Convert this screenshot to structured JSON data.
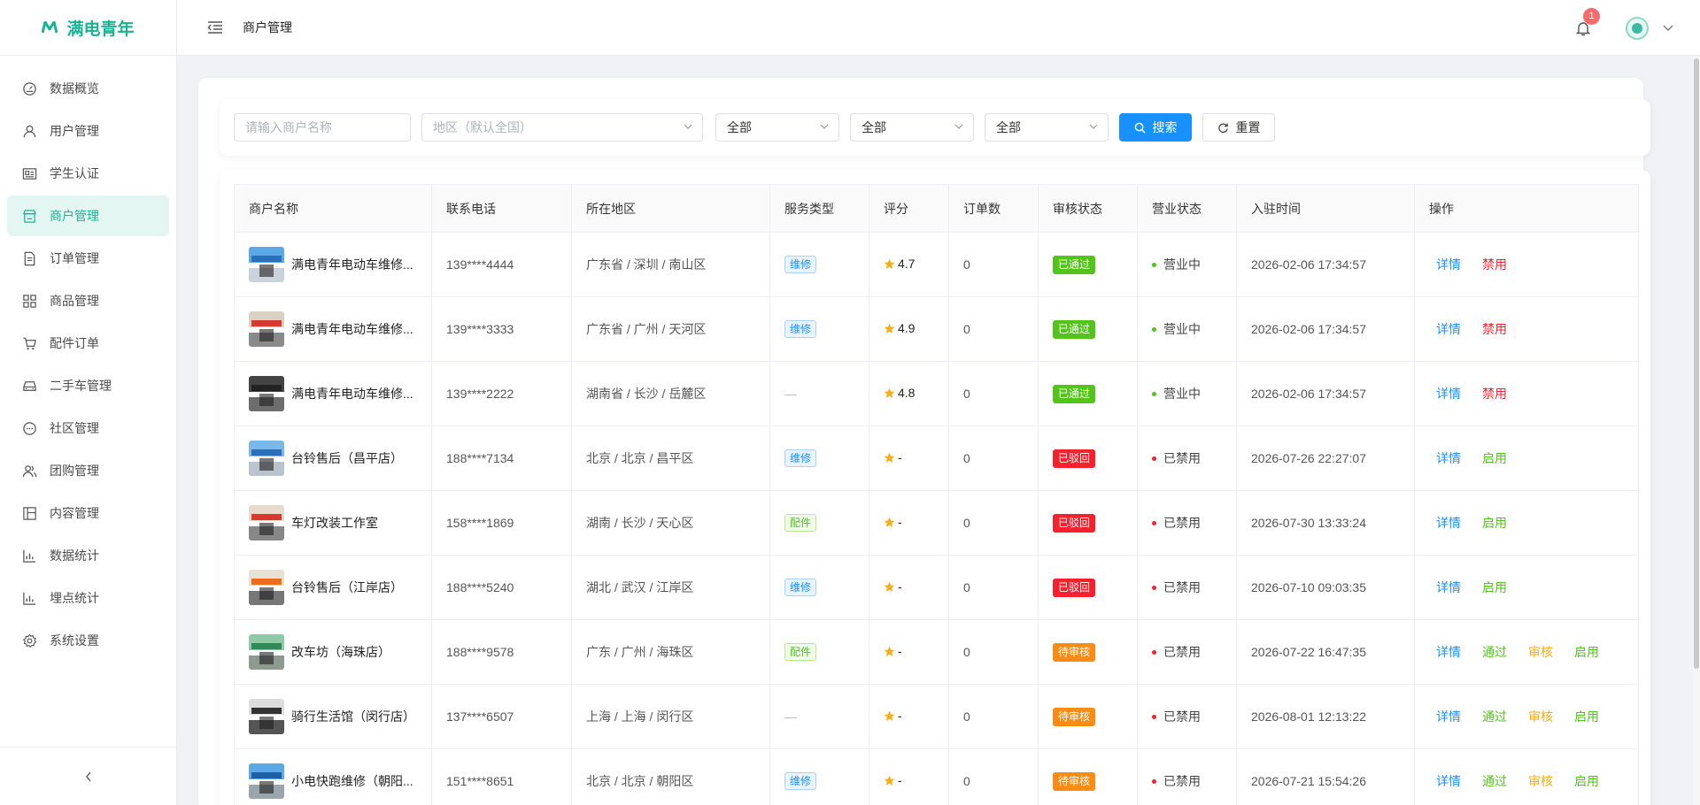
{
  "app": {
    "logo_mark": "M",
    "title": "满电青年"
  },
  "sidebar": {
    "items": [
      {
        "label": "数据概览",
        "icon": "dashboard-icon",
        "active": false
      },
      {
        "label": "用户管理",
        "icon": "user-icon",
        "active": false
      },
      {
        "label": "学生认证",
        "icon": "id-card-icon",
        "active": false
      },
      {
        "label": "商户管理",
        "icon": "store-icon",
        "active": true
      },
      {
        "label": "订单管理",
        "icon": "document-icon",
        "active": false
      },
      {
        "label": "商品管理",
        "icon": "grid-icon",
        "active": false
      },
      {
        "label": "配件订单",
        "icon": "cart-icon",
        "active": false
      },
      {
        "label": "二手车管理",
        "icon": "car-icon",
        "active": false
      },
      {
        "label": "社区管理",
        "icon": "chat-icon",
        "active": false
      },
      {
        "label": "团购管理",
        "icon": "group-icon",
        "active": false
      },
      {
        "label": "内容管理",
        "icon": "layout-icon",
        "active": false
      },
      {
        "label": "数据统计",
        "icon": "bar-chart-icon",
        "active": false
      },
      {
        "label": "埋点统计",
        "icon": "bar-chart-icon",
        "active": false
      },
      {
        "label": "系统设置",
        "icon": "gear-icon",
        "active": false
      }
    ],
    "collapse_glyph": "‹"
  },
  "header": {
    "breadcrumb": "商户管理",
    "notification_count": "1"
  },
  "filters": {
    "name_placeholder": "请输入商户名称",
    "region_placeholder": "地区（默认全国）",
    "select1": "全部",
    "select2": "全部",
    "select3": "全部",
    "search_label": "搜索",
    "reset_label": "重置"
  },
  "table": {
    "columns": [
      "商户名称",
      "联系电话",
      "所在地区",
      "服务类型",
      "评分",
      "订单数",
      "审核状态",
      "营业状态",
      "入驻时间",
      "操作"
    ],
    "rows": [
      {
        "name": "满电青年电动车维修...",
        "phone": "139****4444",
        "region": "广东省 / 深圳 / 南山区",
        "service": "维修",
        "rating": "4.7",
        "orders": "0",
        "audit": "已通过",
        "biz": "营业中",
        "time": "2026-02-06 17:34:57",
        "ops": [
          "详情",
          "禁用"
        ]
      },
      {
        "name": "满电青年电动车维修...",
        "phone": "139****3333",
        "region": "广东省 / 广州 / 天河区",
        "service": "维修",
        "rating": "4.9",
        "orders": "0",
        "audit": "已通过",
        "biz": "营业中",
        "time": "2026-02-06 17:34:57",
        "ops": [
          "详情",
          "禁用"
        ]
      },
      {
        "name": "满电青年电动车维修...",
        "phone": "139****2222",
        "region": "湖南省 / 长沙 / 岳麓区",
        "service": "—",
        "rating": "4.8",
        "orders": "0",
        "audit": "已通过",
        "biz": "营业中",
        "time": "2026-02-06 17:34:57",
        "ops": [
          "详情",
          "禁用"
        ]
      },
      {
        "name": "台铃售后（昌平店）",
        "phone": "188****7134",
        "region": "北京 / 北京 / 昌平区",
        "service": "维修",
        "rating": "-",
        "orders": "0",
        "audit": "已驳回",
        "biz": "已禁用",
        "time": "2026-07-26 22:27:07",
        "ops": [
          "详情",
          "启用"
        ]
      },
      {
        "name": "车灯改装工作室",
        "phone": "158****1869",
        "region": "湖南 / 长沙 / 天心区",
        "service": "配件",
        "rating": "-",
        "orders": "0",
        "audit": "已驳回",
        "biz": "已禁用",
        "time": "2026-07-30 13:33:24",
        "ops": [
          "详情",
          "启用"
        ]
      },
      {
        "name": "台铃售后（江岸店）",
        "phone": "188****5240",
        "region": "湖北 / 武汉 / 江岸区",
        "service": "维修",
        "rating": "-",
        "orders": "0",
        "audit": "已驳回",
        "biz": "已禁用",
        "time": "2026-07-10 09:03:35",
        "ops": [
          "详情",
          "启用"
        ]
      },
      {
        "name": "改车坊（海珠店）",
        "phone": "188****9578",
        "region": "广东 / 广州 / 海珠区",
        "service": "配件",
        "rating": "-",
        "orders": "0",
        "audit": "待审核",
        "biz": "已禁用",
        "time": "2026-07-22 16:47:35",
        "ops": [
          "详情",
          "通过",
          "审核",
          "启用"
        ]
      },
      {
        "name": "骑行生活馆（闵行店）",
        "phone": "137****6507",
        "region": "上海 / 上海 / 闵行区",
        "service": "—",
        "rating": "-",
        "orders": "0",
        "audit": "待审核",
        "biz": "已禁用",
        "time": "2026-08-01 12:13:22",
        "ops": [
          "详情",
          "通过",
          "审核",
          "启用"
        ]
      },
      {
        "name": "小电快跑维修（朝阳...",
        "phone": "151****8651",
        "region": "北京 / 北京 / 朝阳区",
        "service": "维修",
        "rating": "-",
        "orders": "0",
        "audit": "待审核",
        "biz": "已禁用",
        "time": "2026-07-21 15:54:26",
        "ops": [
          "详情",
          "通过",
          "审核",
          "启用"
        ]
      }
    ]
  },
  "colors": {
    "brand": "#1ab394",
    "primary": "#1890ff",
    "approved": "#52c41a",
    "rejected": "#f5222d",
    "pending": "#fa8c16",
    "danger_link": "#f5222d",
    "success_link": "#52c41a",
    "warning_link": "#faad14",
    "star": "#faad14"
  }
}
